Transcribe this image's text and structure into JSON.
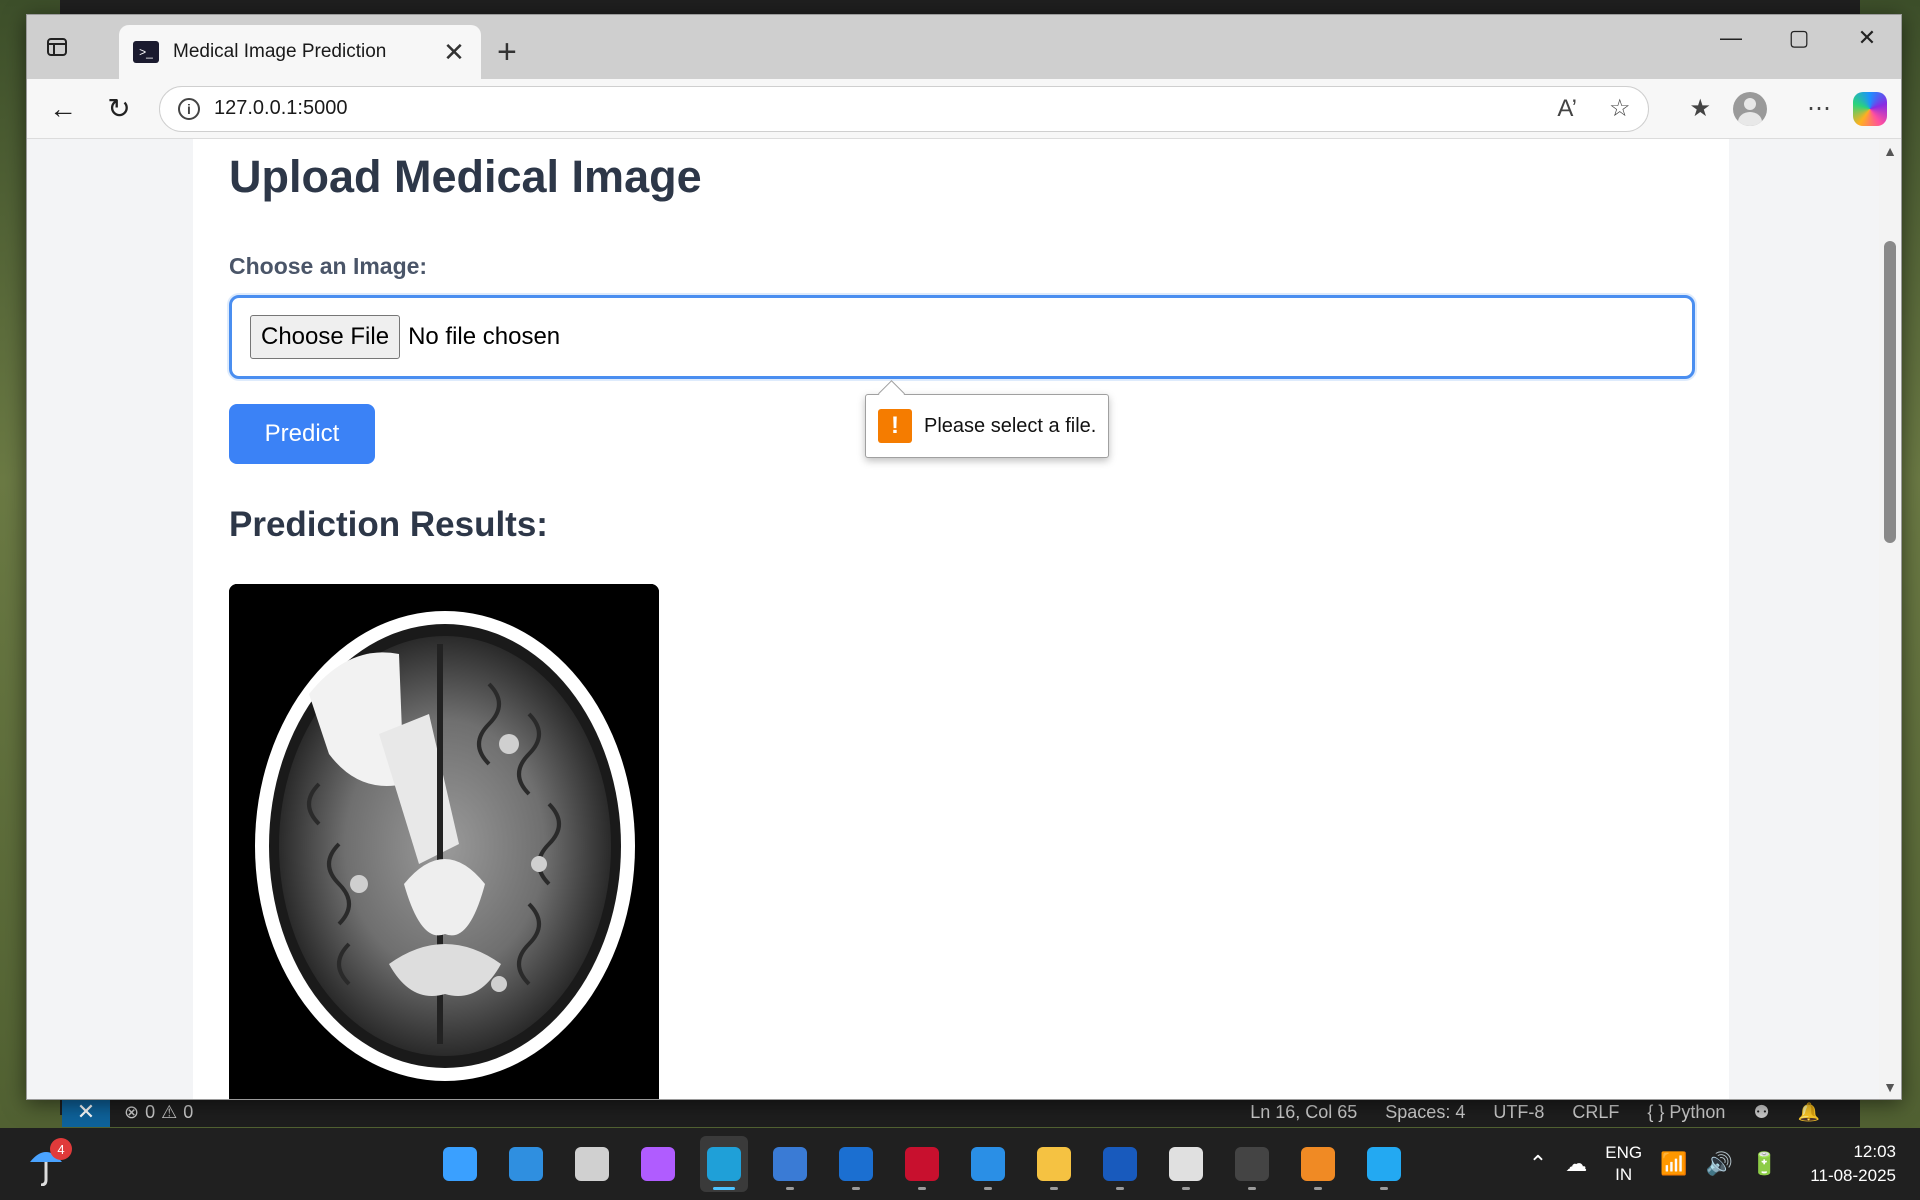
{
  "browser": {
    "tab_title": "Medical Image Prediction",
    "url": "127.0.0.1:5000"
  },
  "page": {
    "title": "Upload Medical Image",
    "field_label": "Choose an Image:",
    "choose_file_label": "Choose File",
    "file_status": "No file chosen",
    "predict_label": "Predict",
    "validation_message": "Please select a file.",
    "results_heading": "Prediction Results:"
  },
  "vscode_status": {
    "errors": "0",
    "warnings": "0",
    "cursor": "Ln 16, Col 65",
    "spaces": "Spaces: 4",
    "encoding": "UTF-8",
    "eol": "CRLF",
    "language": "Python"
  },
  "taskbar": {
    "weather_badge": "4",
    "lang_line1": "ENG",
    "lang_line2": "IN",
    "time": "12:03",
    "date": "11-08-2025",
    "apps": [
      {
        "name": "start-icon",
        "color": "#3aa0ff"
      },
      {
        "name": "search-icon",
        "color": "#2f8fe0"
      },
      {
        "name": "task-view-icon",
        "color": "#d0d0d0"
      },
      {
        "name": "copilot-icon",
        "color": "#b05cff"
      },
      {
        "name": "edge-icon",
        "color": "#1fa0d8"
      },
      {
        "name": "store-icon",
        "color": "#3a7bd5"
      },
      {
        "name": "hp-icon",
        "color": "#1b6fd1"
      },
      {
        "name": "mcafee-icon",
        "color": "#c8102e"
      },
      {
        "name": "help-icon",
        "color": "#2a8fe6"
      },
      {
        "name": "file-explorer-icon",
        "color": "#f5c242"
      },
      {
        "name": "word-icon",
        "color": "#185abd"
      },
      {
        "name": "snipping-tool-icon",
        "color": "#e0e0e0"
      },
      {
        "name": "terminal-icon",
        "color": "#444444"
      },
      {
        "name": "media-player-icon",
        "color": "#f08a24"
      },
      {
        "name": "vscode-icon",
        "color": "#23a9f2"
      }
    ]
  },
  "colors": {
    "accent": "#3b82f6",
    "warning": "#f57c00",
    "focus_ring": "#4a8ef0"
  }
}
